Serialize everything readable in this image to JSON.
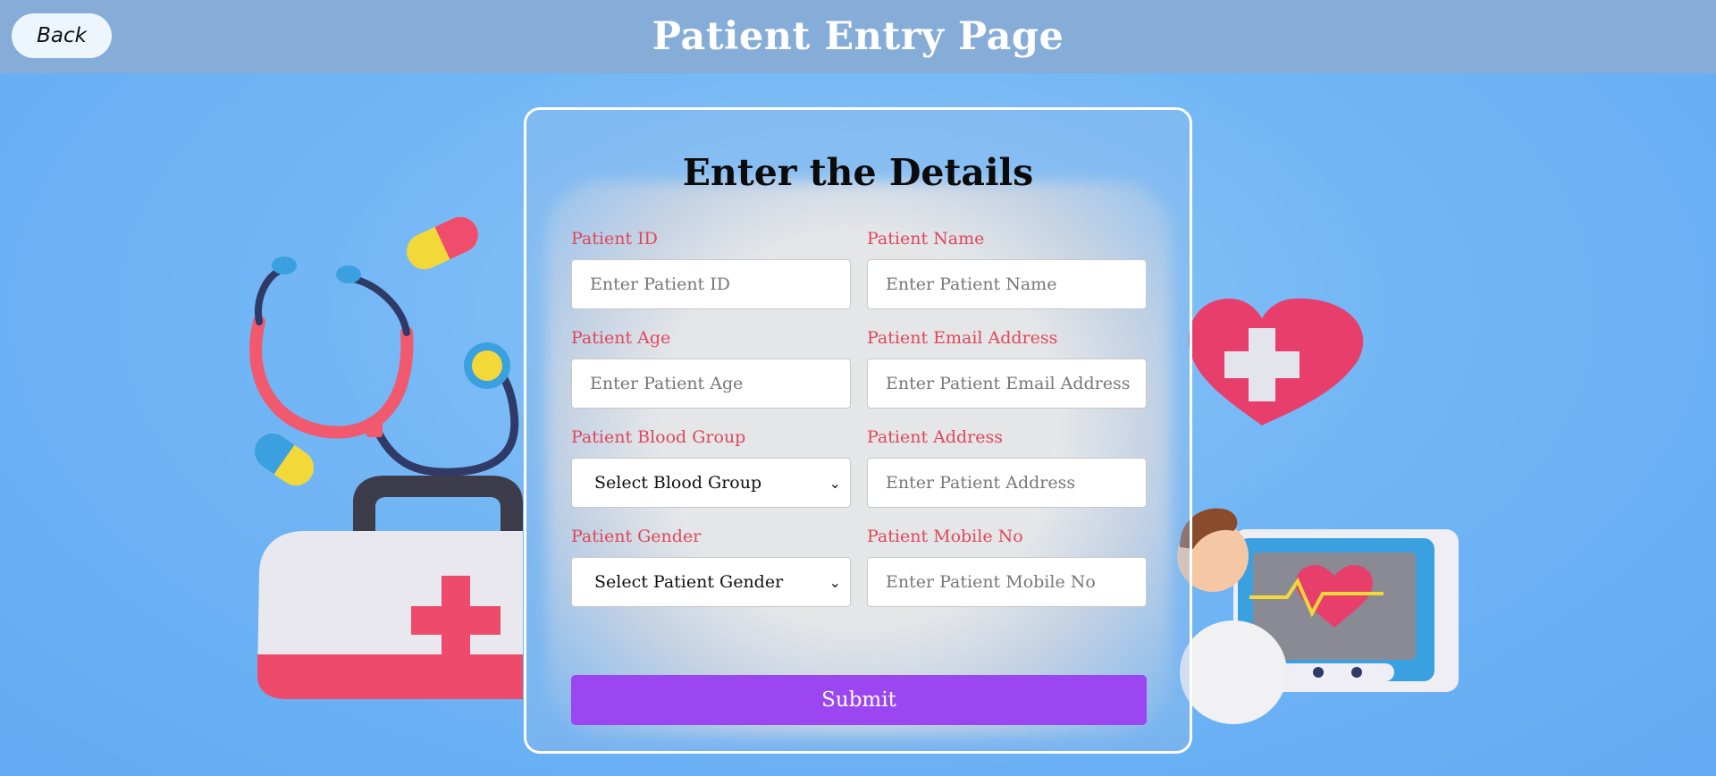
{
  "header": {
    "back_label": "Back",
    "title": "Patient Entry Page"
  },
  "form": {
    "title": "Enter the Details",
    "fields": {
      "patient_id": {
        "label": "Patient ID",
        "placeholder": "Enter Patient ID"
      },
      "patient_name": {
        "label": "Patient Name",
        "placeholder": "Enter Patient Name"
      },
      "patient_age": {
        "label": "Patient Age",
        "placeholder": "Enter Patient Age"
      },
      "patient_email": {
        "label": "Patient Email Address",
        "placeholder": "Enter Patient Email Address"
      },
      "blood_group": {
        "label": "Patient Blood Group",
        "selected": "Select Blood Group"
      },
      "patient_address": {
        "label": "Patient Address",
        "placeholder": "Enter Patient Address"
      },
      "patient_gender": {
        "label": "Patient Gender",
        "selected": "Select Patient Gender"
      },
      "patient_mobile": {
        "label": "Patient Mobile No",
        "placeholder": "Enter Patient Mobile No"
      }
    },
    "submit_label": "Submit"
  },
  "colors": {
    "header_bg": "#86acd8",
    "label": "#e0475a",
    "submit_bg": "#9b46f0"
  },
  "icons": {
    "back": "none",
    "select_arrow": "chevron-down-icon"
  }
}
